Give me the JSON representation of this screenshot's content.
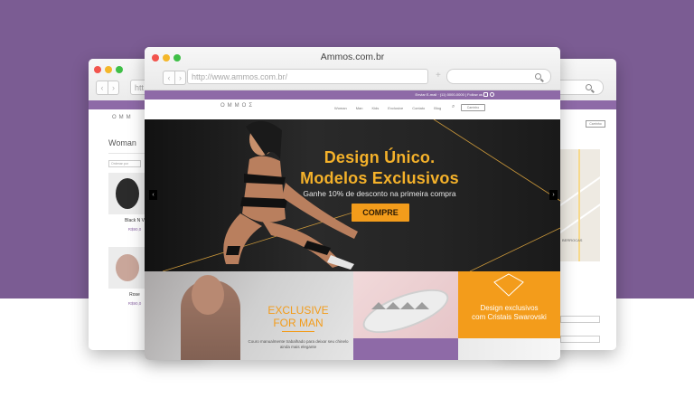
{
  "main_window": {
    "title": "Ammos.com.br",
    "url": "http://www.ammos.com.br/",
    "top_strip": "Enviar E-mail  ·  (11) 0000-0000  |  Follow us",
    "nav": {
      "logo_letters": [
        "Ο",
        "Μ",
        "Μ",
        "Ο",
        "Σ"
      ],
      "items": [
        "Woman",
        "Man",
        "Kids",
        "Exclusive",
        "Contato",
        "Blog"
      ],
      "cart_label": "Carrinho"
    },
    "hero": {
      "title_line1": "Design Único.",
      "title_line2": "Modelos Exclusivos",
      "subtitle": "Ganhe 10% de desconto na primeira compra",
      "cta": "COMPRE",
      "prev": "‹",
      "next": "›"
    },
    "promo_man": {
      "title_line1": "EXCLUSIVE",
      "title_line2": "FOR MAN",
      "desc": "Couro manualmente trabalhado para deixar seu chinelo ainda mais elegante"
    },
    "promo_swarovski": {
      "line1": "Design exclusivos",
      "line2": "com Cristais Swarovski"
    }
  },
  "left_window": {
    "url": "htt",
    "logo_letters": [
      "Ο",
      "Μ",
      "Μ"
    ],
    "heading": "Woman",
    "sort_label": "Ordenar por",
    "products": [
      {
        "name": "Black N V",
        "price": "R$90,0"
      },
      {
        "name": "Rose",
        "price": "R$90,0"
      }
    ]
  },
  "right_window": {
    "strip_text": "amos  |  Follow us",
    "map_label": "BERROCAS",
    "cart_label": "Carrinho"
  },
  "colors": {
    "purple_bg": "#7b5c93",
    "site_purple": "#8e6aa7",
    "accent_orange": "#f39c1b",
    "hero_text": "#f4b12a"
  }
}
